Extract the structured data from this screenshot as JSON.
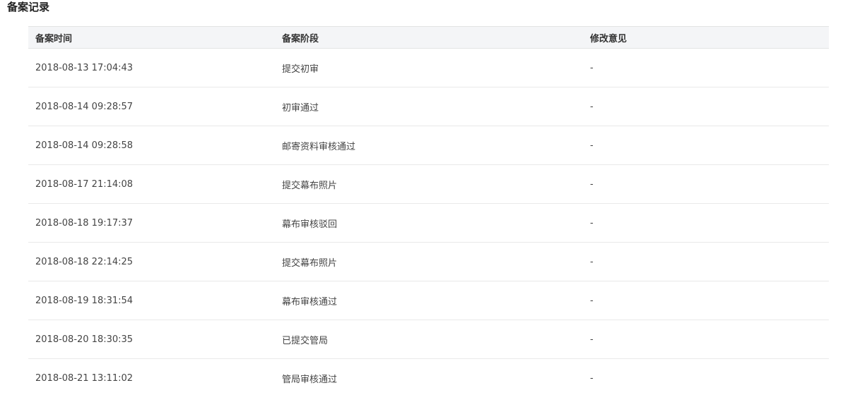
{
  "section": {
    "title": "备案记录"
  },
  "table": {
    "headers": {
      "time": "备案时间",
      "stage": "备案阶段",
      "opinion": "修改意见"
    },
    "rows": [
      {
        "time": "2018-08-13 17:04:43",
        "stage": "提交初审",
        "opinion": "-"
      },
      {
        "time": "2018-08-14 09:28:57",
        "stage": "初审通过",
        "opinion": "-"
      },
      {
        "time": "2018-08-14 09:28:58",
        "stage": "邮寄资料审核通过",
        "opinion": "-"
      },
      {
        "time": "2018-08-17 21:14:08",
        "stage": "提交幕布照片",
        "opinion": "-"
      },
      {
        "time": "2018-08-18 19:17:37",
        "stage": "幕布审核驳回",
        "opinion": "-"
      },
      {
        "time": "2018-08-18 22:14:25",
        "stage": "提交幕布照片",
        "opinion": "-"
      },
      {
        "time": "2018-08-19 18:31:54",
        "stage": "幕布审核通过",
        "opinion": "-"
      },
      {
        "time": "2018-08-20 18:30:35",
        "stage": "已提交管局",
        "opinion": "-"
      },
      {
        "time": "2018-08-21 13:11:02",
        "stage": "管局审核通过",
        "opinion": "-"
      }
    ]
  }
}
